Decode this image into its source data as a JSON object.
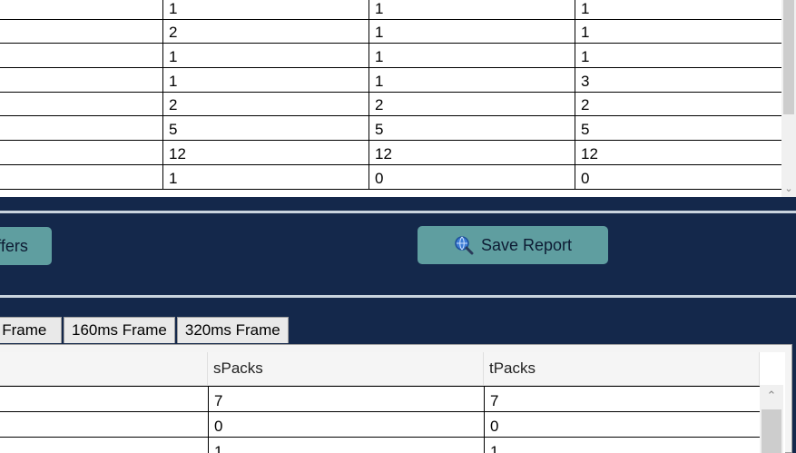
{
  "top_table": {
    "rows": [
      [
        "",
        "1",
        "1",
        "1"
      ],
      [
        "",
        "2",
        "1",
        "1"
      ],
      [
        "",
        "1",
        "1",
        "1"
      ],
      [
        "",
        "1",
        "1",
        "3"
      ],
      [
        "",
        "2",
        "2",
        "2"
      ],
      [
        "",
        "5",
        "5",
        "5"
      ],
      [
        "",
        "12",
        "12",
        "12"
      ],
      [
        "",
        "1",
        "0",
        "0"
      ]
    ]
  },
  "buttons": {
    "buffers_label": "ffers",
    "save_report_label": "Save Report"
  },
  "tabs": [
    {
      "label": "s Frame"
    },
    {
      "label": "160ms Frame"
    },
    {
      "label": "320ms Frame"
    }
  ],
  "bottom_table": {
    "headers": [
      "",
      "sPacks",
      "tPacks"
    ],
    "rows": [
      [
        "",
        "7",
        "7"
      ],
      [
        "",
        "0",
        "0"
      ],
      [
        "",
        "1",
        "1"
      ]
    ]
  },
  "colors": {
    "background": "#14284b",
    "button": "#5f9ea0"
  },
  "icons": {
    "save_report": "search-globe-icon",
    "scroll_down": "chevron-down-icon",
    "scroll_up": "chevron-up-icon"
  }
}
